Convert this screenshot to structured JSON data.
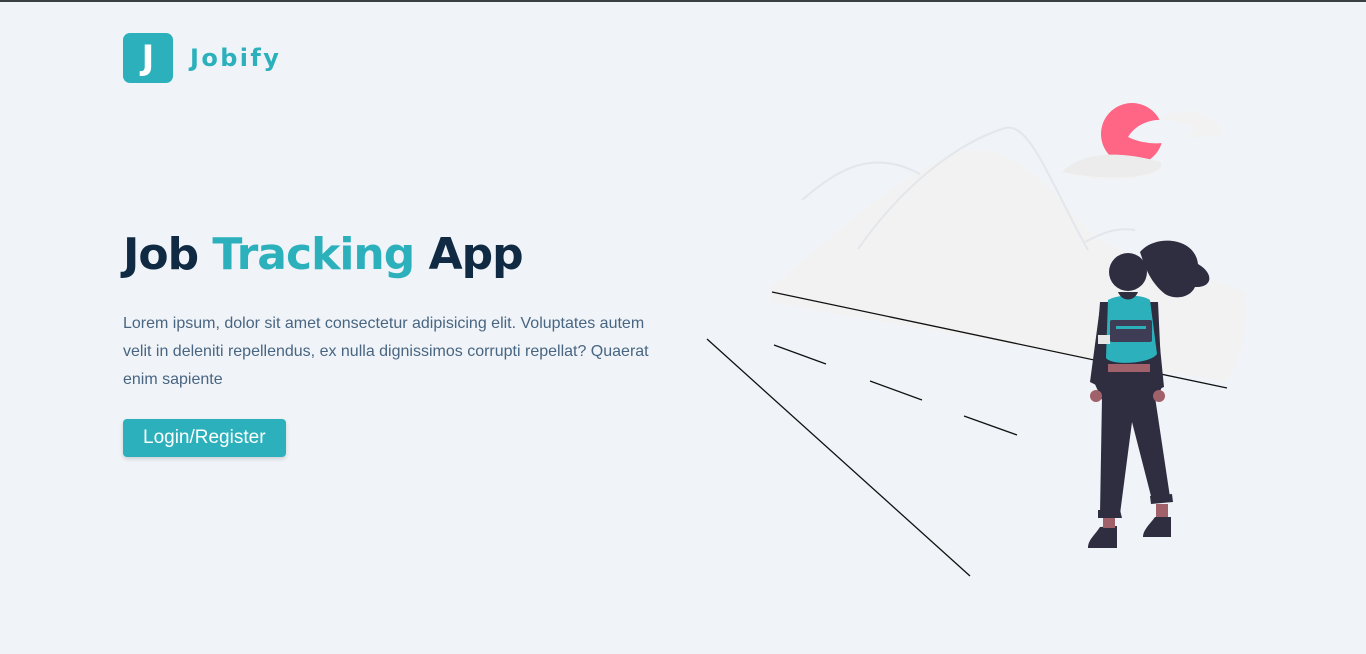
{
  "brand": {
    "logo_letter": "J",
    "name": "Jobify",
    "color": "#2cb1bc"
  },
  "hero": {
    "title_part1": "Job ",
    "title_accent": "Tracking",
    "title_part2": " App",
    "text": "Lorem ipsum, dolor sit amet consectetur adipisicing elit. Voluptates autem velit in deleniti repellendus, ex nulla dignissimos corrupti repellat? Quaerat enim sapiente",
    "button_label": "Login/Register"
  },
  "colors": {
    "background": "#f0f4f8",
    "heading": "#102a43",
    "body_text": "#486581",
    "sun": "#ff6584",
    "figure_dark": "#2f2e41"
  }
}
